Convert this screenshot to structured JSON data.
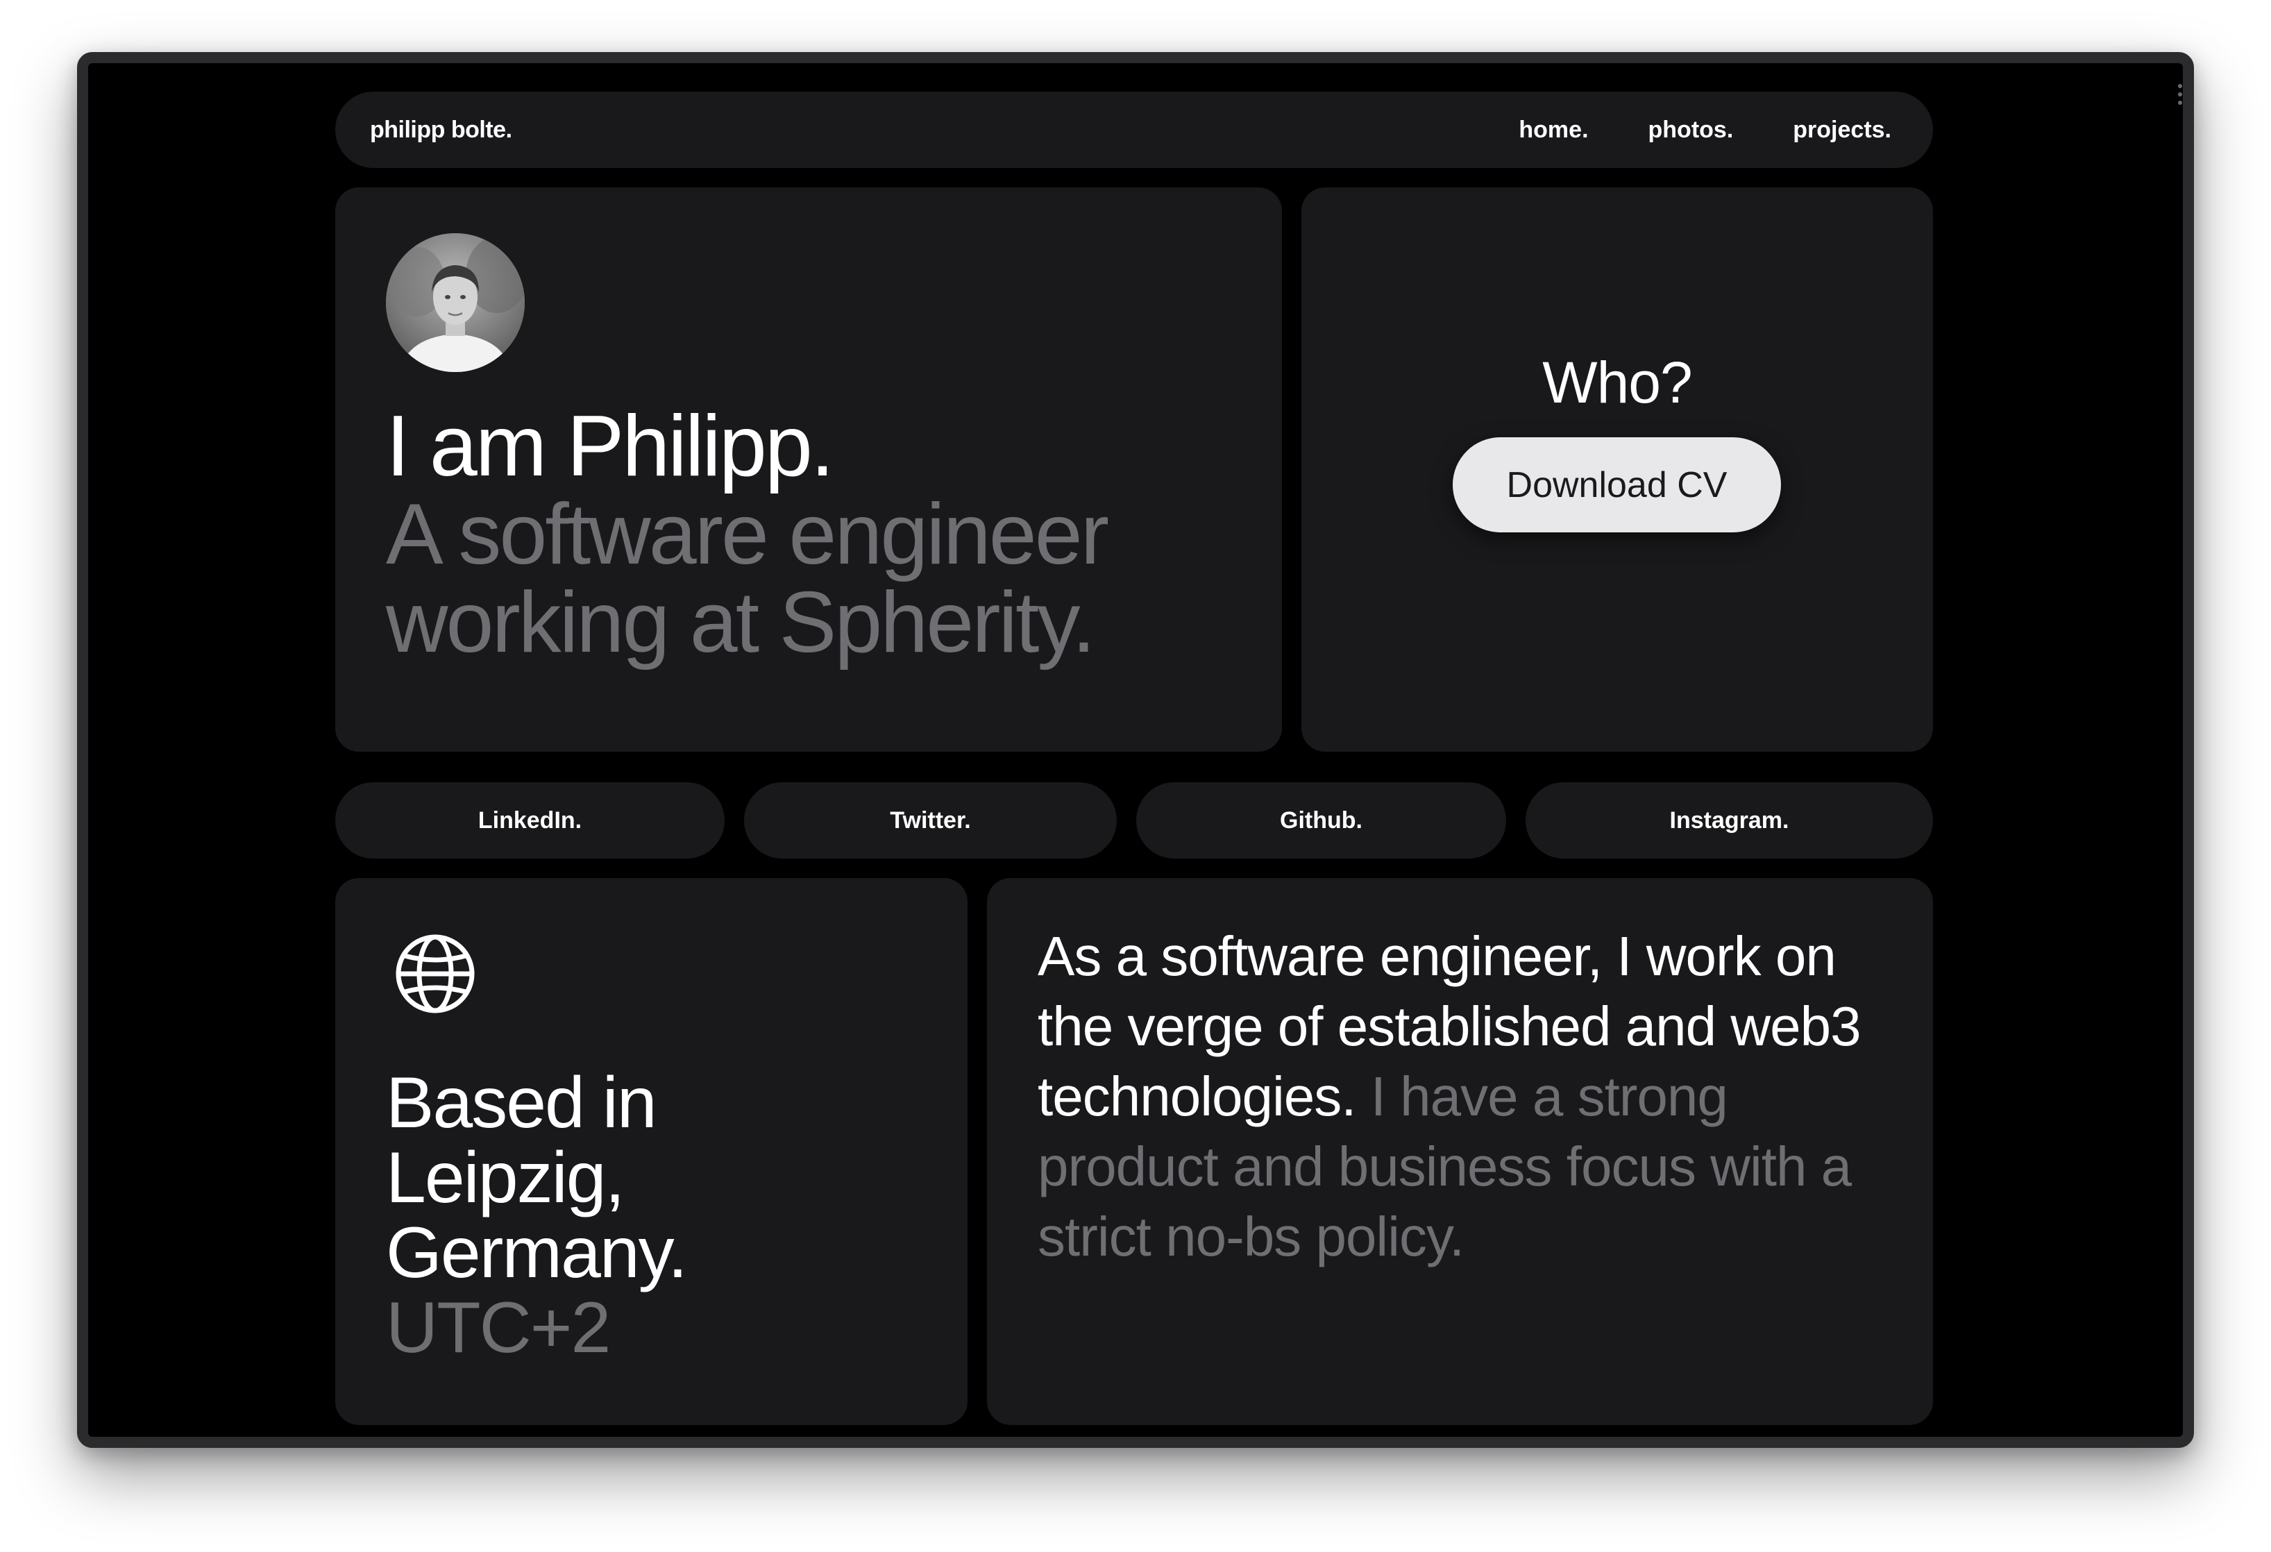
{
  "nav": {
    "brand": "philipp bolte.",
    "links": [
      "home.",
      "photos.",
      "projects."
    ]
  },
  "hero": {
    "heading": "I am Philipp.",
    "subheading": "A software engineer working at Spherity.",
    "avatar_alt": "Portrait of Philipp"
  },
  "who": {
    "title": "Who?",
    "button_label": "Download CV"
  },
  "social": [
    "LinkedIn.",
    "Twitter.",
    "Github.",
    "Instagram."
  ],
  "location": {
    "icon": "globe-icon",
    "text": "Based in Leipzig, Germany.",
    "timezone": "UTC+2"
  },
  "about": {
    "primary": "As a software engineer, I work on the verge of established and web3 technologies.",
    "secondary": "I have a strong product and business focus with a strict no-bs policy."
  },
  "colors": {
    "page_background": "#000000",
    "card_background": "#19191b",
    "text_primary": "#ffffff",
    "text_secondary": "#6e6e73",
    "button_background": "#e8e8ea"
  }
}
